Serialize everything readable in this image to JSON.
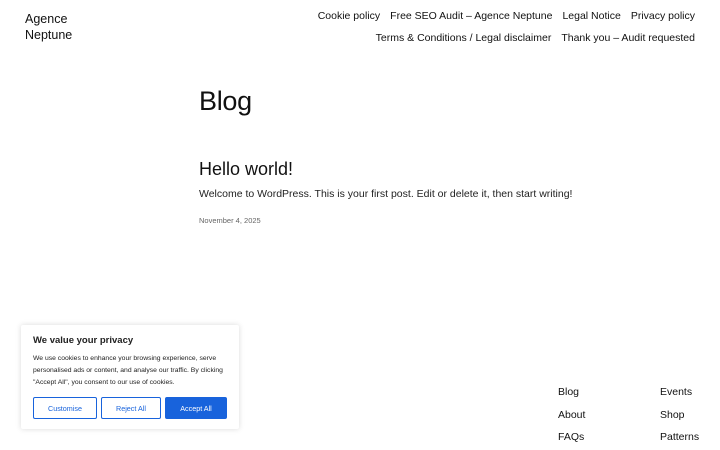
{
  "site": {
    "title": "Agence Neptune"
  },
  "nav": {
    "items": [
      {
        "label": "Cookie policy"
      },
      {
        "label": "Free SEO Audit – Agence Neptune"
      },
      {
        "label": "Legal Notice"
      },
      {
        "label": "Privacy policy"
      },
      {
        "label": "Terms & Conditions / Legal disclaimer"
      },
      {
        "label": "Thank you – Audit requested"
      }
    ]
  },
  "main": {
    "title": "Blog",
    "posts": [
      {
        "title": "Hello world!",
        "excerpt": "Welcome to WordPress. This is your first post. Edit or delete it, then start writing!",
        "date": "November 4, 2025"
      }
    ]
  },
  "cookie_banner": {
    "title": "We value your privacy",
    "text": "We use cookies to enhance your browsing experience, serve personalised ads or content, and analyse our traffic. By clicking \"Accept All\", you consent to our use of cookies.",
    "customise_label": "Customise",
    "reject_label": "Reject All",
    "accept_label": "Accept All",
    "accent_color": "#1863dc"
  },
  "footer": {
    "links": [
      {
        "label": "Blog"
      },
      {
        "label": "Events"
      },
      {
        "label": "About"
      },
      {
        "label": "Shop"
      },
      {
        "label": "FAQs"
      },
      {
        "label": "Patterns"
      }
    ]
  }
}
